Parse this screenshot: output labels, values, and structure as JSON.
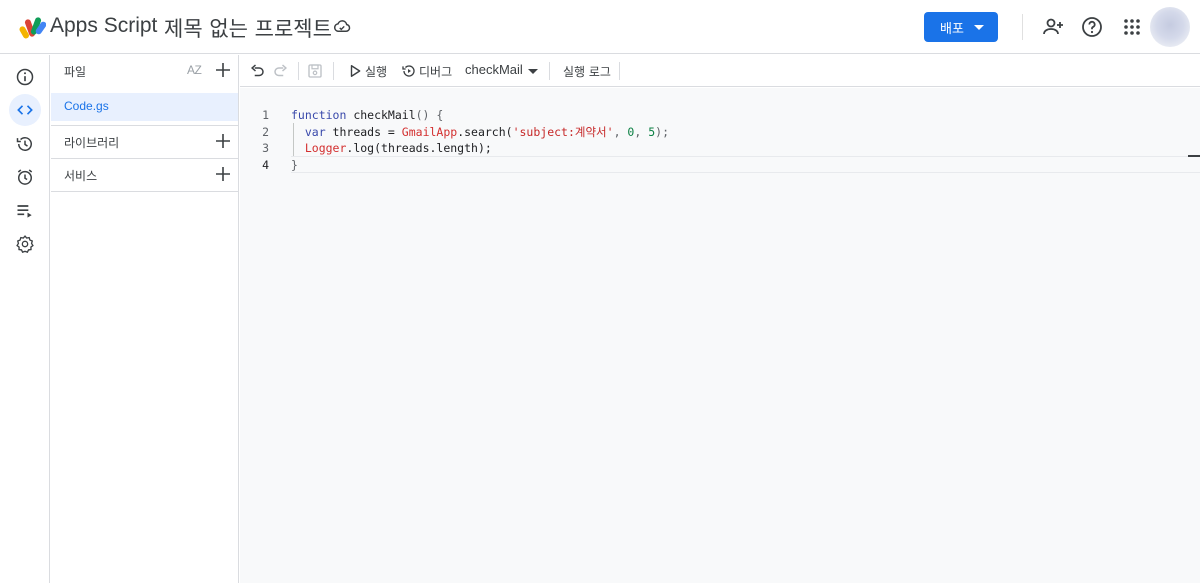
{
  "header": {
    "app_name": "Apps Script",
    "project_title": "제목 없는 프로젝트",
    "deploy_label": "배포",
    "icons": [
      "apps-script-logo",
      "cloud-icon",
      "add-person-icon",
      "help-icon",
      "apps-grid-icon",
      "avatar"
    ]
  },
  "rail": {
    "items": [
      {
        "name": "overview",
        "icon": "info-icon"
      },
      {
        "name": "editor",
        "icon": "code-icon",
        "active": true
      },
      {
        "name": "executions",
        "icon": "history-icon"
      },
      {
        "name": "triggers",
        "icon": "alarm-icon"
      },
      {
        "name": "deployments",
        "icon": "playlist-icon"
      },
      {
        "name": "settings",
        "icon": "gear-icon"
      }
    ]
  },
  "files": {
    "files_label": "파일",
    "sort_label": "AZ",
    "active_file": "Code.gs",
    "libraries_label": "라이브러리",
    "services_label": "서비스"
  },
  "toolbar": {
    "run_label": "실행",
    "debug_label": "디버그",
    "function_name": "checkMail",
    "log_label": "실행 로그"
  },
  "editor": {
    "line_numbers": [
      "1",
      "2",
      "3",
      "4"
    ],
    "lines": [
      [
        {
          "t": "function ",
          "c": "kw"
        },
        {
          "t": "checkMail",
          "c": "id"
        },
        {
          "t": "() {",
          "c": "punc"
        }
      ],
      [
        {
          "t": "  var ",
          "c": "kw"
        },
        {
          "t": "threads = ",
          "c": "id"
        },
        {
          "t": "GmailApp",
          "c": "cls"
        },
        {
          "t": ".search(",
          "c": "id"
        },
        {
          "t": "'subject:계약서'",
          "c": "str"
        },
        {
          "t": ", ",
          "c": "punc"
        },
        {
          "t": "0",
          "c": "num"
        },
        {
          "t": ", ",
          "c": "punc"
        },
        {
          "t": "5",
          "c": "num"
        },
        {
          "t": ");",
          "c": "punc"
        }
      ],
      [
        {
          "t": "  ",
          "c": "id"
        },
        {
          "t": "Logger",
          "c": "cls"
        },
        {
          "t": ".log(threads.length);",
          "c": "id"
        }
      ],
      [
        {
          "t": "}",
          "c": "punc"
        }
      ]
    ]
  },
  "colors": {
    "accent": "#1a73e8",
    "selected_bg": "#e8f0fe",
    "editor_bg": "#f8f9fa"
  }
}
